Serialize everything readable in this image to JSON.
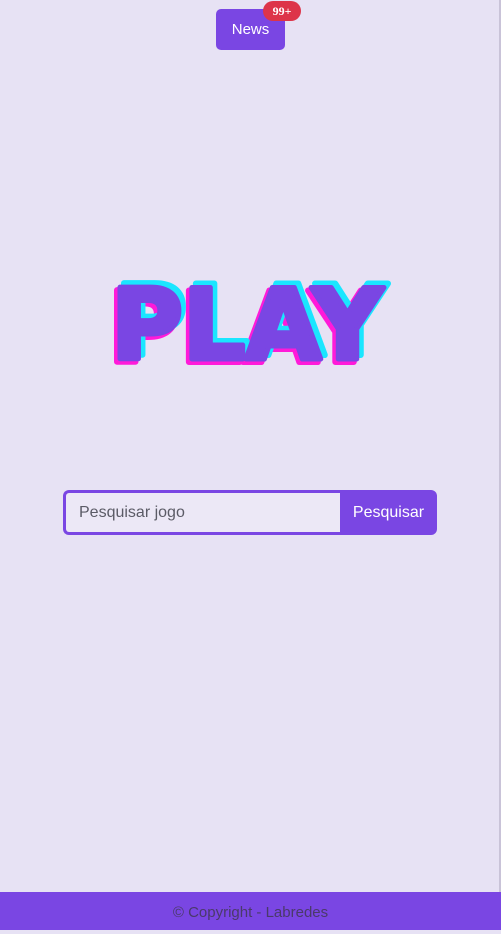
{
  "header": {
    "news_label": "News",
    "news_badge": "99+"
  },
  "logo": {
    "text": "PLAY",
    "colors": {
      "fill": "#7a46e3",
      "shadow_magenta": "#ff1ad9",
      "shadow_cyan": "#1ae6ff"
    }
  },
  "search": {
    "placeholder": "Pesquisar jogo",
    "value": "",
    "button_label": "Pesquisar"
  },
  "footer": {
    "text": "© Copyright - Labredes"
  },
  "colors": {
    "background": "#e7e2f4",
    "accent": "#7a46e3",
    "badge": "#dd3449"
  }
}
